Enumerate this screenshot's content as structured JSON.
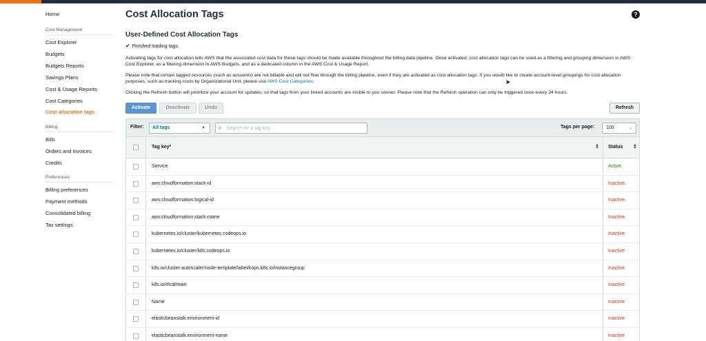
{
  "sidebar": {
    "home": "Home",
    "cost_management_heading": "Cost Management",
    "cost_management_items": [
      "Cost Explorer",
      "Budgets",
      "Budgets Reports",
      "Savings Plans",
      "Cost & Usage Reports",
      "Cost Categories",
      "Cost allocation tags"
    ],
    "billing_heading": "Billing",
    "billing_items": [
      "Bills",
      "Orders and invoices",
      "Credits"
    ],
    "preferences_heading": "Preferences",
    "preferences_items": [
      "Billing preferences",
      "Payment methods",
      "Consolidated billing",
      "Tax settings"
    ],
    "active_item": "Cost allocation tags"
  },
  "page": {
    "title": "Cost Allocation Tags",
    "section_title": "User-Defined Cost Allocation Tags",
    "status": "Finished loading tags.",
    "para1": "Activating tags for cost allocation tells AWS that the associated cost data for these tags should be made available throughout the billing data pipeline. Once activated, cost allocation tags can be used as a filtering and grouping dimension in AWS Cost Explorer, as a filtering dimension in AWS Budgets, and as a dedicated column in the AWS Cost & Usage Report.",
    "para2_text": "Please note that certain tagged resources (such as accounts) are not billable and will not flow through the billing pipeline, even if they are activated as cost allocation tags. If you would like to create account-level groupings for cost allocation purposes, such as tracking costs by Organizational Unit, please use",
    "para2_link": "AWS Cost Categories",
    "para2_end": ".",
    "para3": "Clicking the Refresh button will prioritize your account for updates, so that tags from your linked accounts are visible to you sooner. Please note that the Refresh operation can only be triggered once every 24 hours."
  },
  "toolbar": {
    "activate": "Activate",
    "deactivate": "Deactivate",
    "undo": "Undo",
    "refresh": "Refresh"
  },
  "filter": {
    "label": "Filter:",
    "selected": "All tags",
    "search_placeholder": "Search for a tag key...",
    "per_page_label": "Tags per page:",
    "per_page_value": "100"
  },
  "table": {
    "columns": [
      "Tag key*",
      "Status"
    ],
    "rows": [
      {
        "key": "Service",
        "status": "Active"
      },
      {
        "key": "aws:cloudformation:stack-id",
        "status": "Inactive"
      },
      {
        "key": "aws:cloudformation:logical-id",
        "status": "Inactive"
      },
      {
        "key": "aws:cloudformation:stack-name",
        "status": "Inactive"
      },
      {
        "key": "kubernetes.io/cluster/kubernetes.codeops.io",
        "status": "Inactive"
      },
      {
        "key": "kubernetes.io/cluster/k8s.codeops.io",
        "status": "Inactive"
      },
      {
        "key": "k8s.io/cluster-autoscaler/node-template/label/kops.k8s.io/instancegroup",
        "status": "Inactive"
      },
      {
        "key": "k8s.io/etcd/main",
        "status": "Inactive"
      },
      {
        "key": "Name",
        "status": "Inactive"
      },
      {
        "key": "elasticbeanstalk:environment-id",
        "status": "Inactive"
      },
      {
        "key": "elasticbeanstalk:environment-name",
        "status": "Inactive"
      }
    ]
  },
  "colors": {
    "accent_orange": "#ec7211",
    "primary_button": "#5b95cf",
    "link_blue": "#0073bb",
    "active_green": "#1d8102",
    "inactive_red": "#d13212"
  }
}
